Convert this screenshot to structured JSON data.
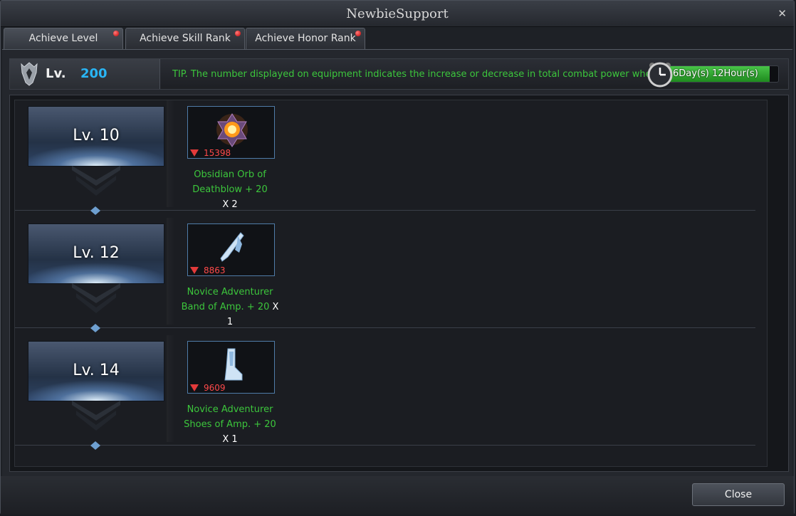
{
  "window": {
    "title": "NewbieSupport"
  },
  "tabs": [
    {
      "label": "Achieve Level",
      "active": true,
      "notification": true
    },
    {
      "label": "Achieve Skill Rank",
      "active": false,
      "notification": true
    },
    {
      "label": "Achieve Honor Rank",
      "active": false,
      "notification": true
    }
  ],
  "level_bar": {
    "label": "Lv.",
    "value": "200",
    "tip": "TIP. The number displayed on equipment indicates the increase or decrease in total combat power when equipped.",
    "timer": {
      "text": "6Day(s) 12Hour(s)",
      "fill_percent": 92
    }
  },
  "rewards": [
    {
      "level": "Lv. 10",
      "item_name": "Obsidian Orb of Deathblow + 20",
      "quantity": "X 2",
      "power_change": "15398",
      "icon": "orb-icon"
    },
    {
      "level": "Lv. 12",
      "item_name": "Novice Adventurer Band of Amp. + 20",
      "quantity": "X 1",
      "power_change": "8863",
      "icon": "band-icon"
    },
    {
      "level": "Lv. 14",
      "item_name": "Novice Adventurer Shoes of Amp. + 20",
      "quantity": "X 1",
      "power_change": "9609",
      "icon": "shoes-icon"
    }
  ],
  "footer": {
    "close_label": "Close"
  },
  "colors": {
    "accent_level": "#29b6f6",
    "tip_green": "#3cc63c",
    "power_decrease": "#ff4a4a",
    "notification_dot": "#e00000"
  }
}
